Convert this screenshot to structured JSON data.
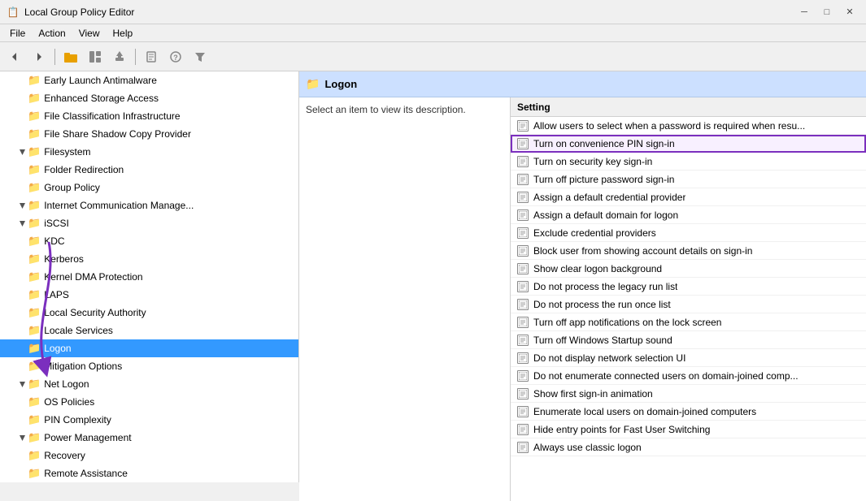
{
  "titleBar": {
    "title": "Local Group Policy Editor",
    "icon": "📋"
  },
  "menuBar": {
    "items": [
      "File",
      "Action",
      "View",
      "Help"
    ]
  },
  "toolbar": {
    "buttons": [
      {
        "name": "back",
        "icon": "◀"
      },
      {
        "name": "forward",
        "icon": "▶"
      },
      {
        "name": "up",
        "icon": "📁"
      },
      {
        "name": "show-hide",
        "icon": "⊞"
      },
      {
        "name": "export",
        "icon": "📤"
      },
      {
        "name": "properties",
        "icon": "ℹ"
      },
      {
        "name": "help",
        "icon": "?"
      },
      {
        "name": "filter",
        "icon": "▼"
      }
    ]
  },
  "leftPanel": {
    "items": [
      {
        "id": "early-launch",
        "label": "Early Launch Antimalware",
        "indent": 1,
        "expandable": false,
        "selected": false
      },
      {
        "id": "enhanced-storage",
        "label": "Enhanced Storage Access",
        "indent": 1,
        "expandable": false,
        "selected": false
      },
      {
        "id": "file-classification",
        "label": "File Classification Infrastructure",
        "indent": 1,
        "expandable": false,
        "selected": false
      },
      {
        "id": "file-share",
        "label": "File Share Shadow Copy Provider",
        "indent": 1,
        "expandable": false,
        "selected": false
      },
      {
        "id": "filesystem",
        "label": "Filesystem",
        "indent": 1,
        "expandable": true,
        "selected": false
      },
      {
        "id": "folder-redirection",
        "label": "Folder Redirection",
        "indent": 1,
        "expandable": false,
        "selected": false
      },
      {
        "id": "group-policy",
        "label": "Group Policy",
        "indent": 1,
        "expandable": false,
        "selected": false
      },
      {
        "id": "internet-comm",
        "label": "Internet Communication Manage...",
        "indent": 1,
        "expandable": true,
        "selected": false
      },
      {
        "id": "iscsi",
        "label": "iSCSI",
        "indent": 1,
        "expandable": true,
        "selected": false
      },
      {
        "id": "kdc",
        "label": "KDC",
        "indent": 1,
        "expandable": false,
        "selected": false
      },
      {
        "id": "kerberos",
        "label": "Kerberos",
        "indent": 1,
        "expandable": false,
        "selected": false
      },
      {
        "id": "kernel-dma",
        "label": "Kernel DMA Protection",
        "indent": 1,
        "expandable": false,
        "selected": false
      },
      {
        "id": "laps",
        "label": "LAPS",
        "indent": 1,
        "expandable": false,
        "selected": false
      },
      {
        "id": "local-security",
        "label": "Local Security Authority",
        "indent": 1,
        "expandable": false,
        "selected": false
      },
      {
        "id": "locale-services",
        "label": "Locale Services",
        "indent": 1,
        "expandable": false,
        "selected": false
      },
      {
        "id": "logon",
        "label": "Logon",
        "indent": 1,
        "expandable": false,
        "selected": true
      },
      {
        "id": "mitigation",
        "label": "Mitigation Options",
        "indent": 1,
        "expandable": false,
        "selected": false
      },
      {
        "id": "net-logon",
        "label": "Net Logon",
        "indent": 1,
        "expandable": true,
        "selected": false
      },
      {
        "id": "os-policies",
        "label": "OS Policies",
        "indent": 1,
        "expandable": false,
        "selected": false
      },
      {
        "id": "pin-complexity",
        "label": "PIN Complexity",
        "indent": 1,
        "expandable": false,
        "selected": false
      },
      {
        "id": "power-management",
        "label": "Power Management",
        "indent": 1,
        "expandable": true,
        "selected": false
      },
      {
        "id": "recovery",
        "label": "Recovery",
        "indent": 1,
        "expandable": false,
        "selected": false
      },
      {
        "id": "remote-assistance",
        "label": "Remote Assistance",
        "indent": 1,
        "expandable": false,
        "selected": false
      }
    ]
  },
  "rightPanel": {
    "header": "Logon",
    "description": "Select an item to view its description.",
    "settingsHeader": "Setting",
    "settings": [
      {
        "id": "s1",
        "label": "Allow users to select when a password is required when resu...",
        "highlighted": false
      },
      {
        "id": "s2",
        "label": "Turn on convenience PIN sign-in",
        "highlighted": true
      },
      {
        "id": "s3",
        "label": "Turn on security key sign-in",
        "highlighted": false
      },
      {
        "id": "s4",
        "label": "Turn off picture password sign-in",
        "highlighted": false
      },
      {
        "id": "s5",
        "label": "Assign a default credential provider",
        "highlighted": false
      },
      {
        "id": "s6",
        "label": "Assign a default domain for logon",
        "highlighted": false
      },
      {
        "id": "s7",
        "label": "Exclude credential providers",
        "highlighted": false
      },
      {
        "id": "s8",
        "label": "Block user from showing account details on sign-in",
        "highlighted": false
      },
      {
        "id": "s9",
        "label": "Show clear logon background",
        "highlighted": false
      },
      {
        "id": "s10",
        "label": "Do not process the legacy run list",
        "highlighted": false
      },
      {
        "id": "s11",
        "label": "Do not process the run once list",
        "highlighted": false
      },
      {
        "id": "s12",
        "label": "Turn off app notifications on the lock screen",
        "highlighted": false
      },
      {
        "id": "s13",
        "label": "Turn off Windows Startup sound",
        "highlighted": false
      },
      {
        "id": "s14",
        "label": "Do not display network selection UI",
        "highlighted": false
      },
      {
        "id": "s15",
        "label": "Do not enumerate connected users on domain-joined comp...",
        "highlighted": false
      },
      {
        "id": "s16",
        "label": "Show first sign-in animation",
        "highlighted": false
      },
      {
        "id": "s17",
        "label": "Enumerate local users on domain-joined computers",
        "highlighted": false
      },
      {
        "id": "s18",
        "label": "Hide entry points for Fast User Switching",
        "highlighted": false
      },
      {
        "id": "s19",
        "label": "Always use classic logon",
        "highlighted": false
      }
    ]
  }
}
